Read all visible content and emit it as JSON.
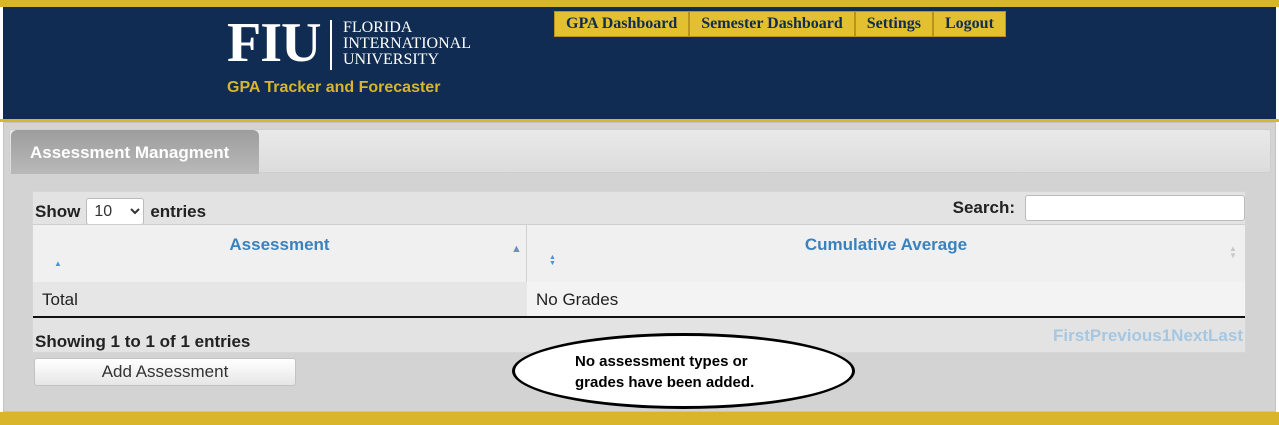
{
  "header": {
    "logo_mark": "FIU",
    "university_lines": [
      "FLORIDA",
      "INTERNATIONAL",
      "UNIVERSITY"
    ],
    "tagline": "GPA Tracker and Forecaster",
    "nav": [
      "GPA Dashboard",
      "Semester Dashboard",
      "Settings",
      "Logout"
    ]
  },
  "colors": {
    "navy": "#112c53",
    "gold": "#d8b52a",
    "link_blue": "#3a82bd"
  },
  "tab": {
    "label": "Assessment Managment"
  },
  "table_controls": {
    "show_label": "Show",
    "length_value": "10",
    "entries_label": "entries",
    "search_label": "Search:",
    "search_value": ""
  },
  "table": {
    "columns": [
      "Assessment",
      "Cumulative Average"
    ],
    "rows": [
      [
        "Total",
        "No Grades"
      ]
    ],
    "info": "Showing 1 to 1 of 1 entries",
    "paging": [
      "First",
      "Previous",
      "1",
      "Next",
      "Last"
    ]
  },
  "actions": {
    "add_assessment": "Add Assessment"
  },
  "callout": {
    "line1": "No assessment types or",
    "line2": "grades have been added."
  }
}
